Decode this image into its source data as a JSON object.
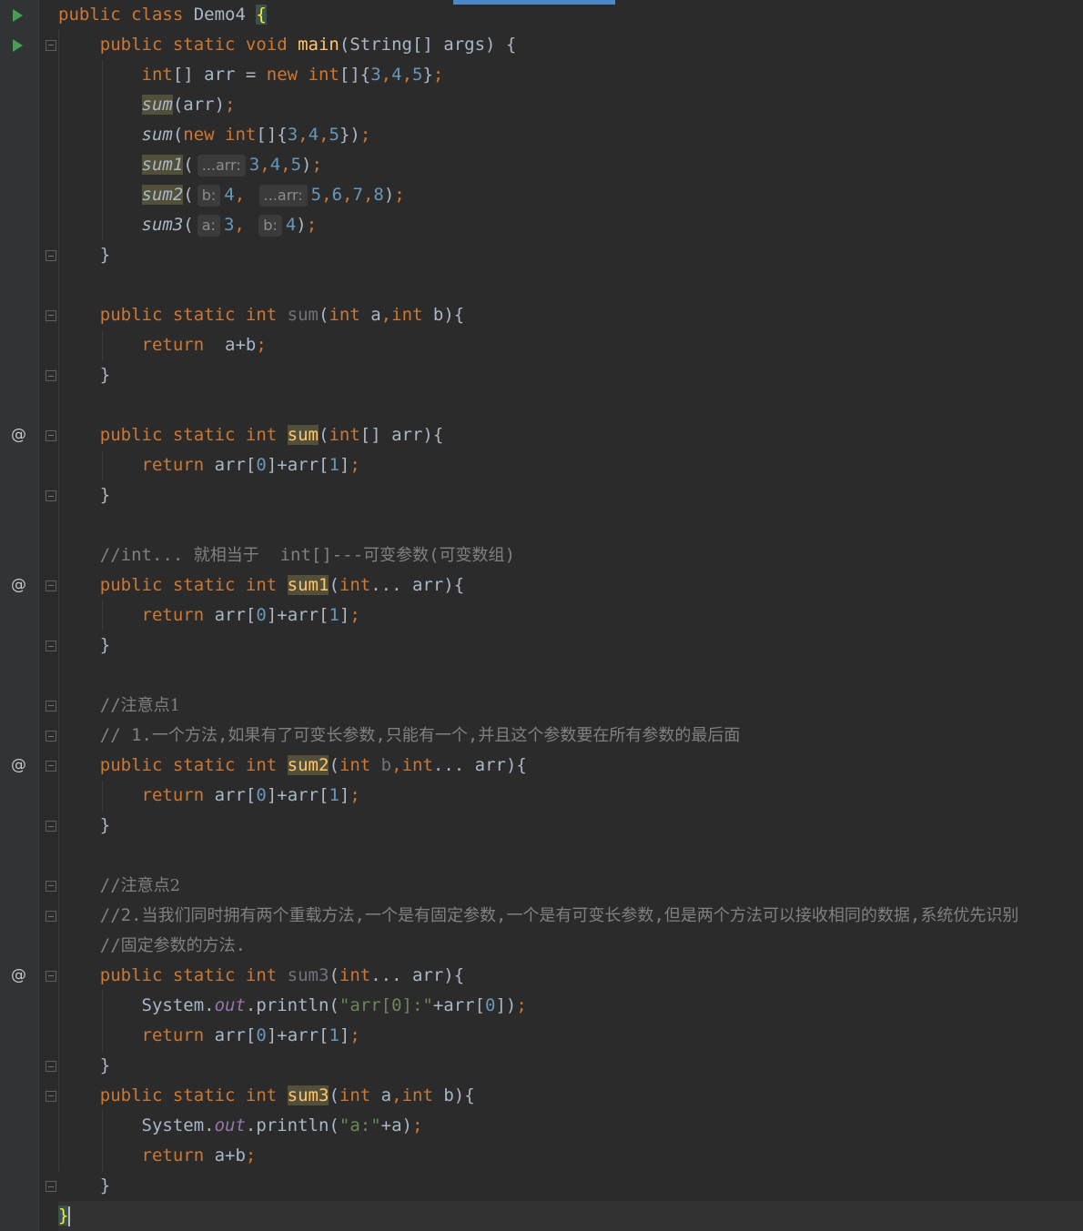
{
  "editor": {
    "language": "java",
    "accent_color": "#4a88c7",
    "lines": [
      {
        "tokens": [
          [
            "kw",
            "public class "
          ],
          [
            "plain",
            "Demo4 "
          ],
          [
            "brace",
            "{"
          ]
        ]
      },
      {
        "tokens": [
          [
            "plain",
            "    "
          ],
          [
            "kw",
            "public static void "
          ],
          [
            "fn",
            "main"
          ],
          [
            "plain",
            "(String[] args) {"
          ]
        ]
      },
      {
        "tokens": [
          [
            "plain",
            "        "
          ],
          [
            "kw",
            "int"
          ],
          [
            "plain",
            "[] arr = "
          ],
          [
            "kw",
            "new int"
          ],
          [
            "plain",
            "[]{"
          ],
          [
            "num",
            "3"
          ],
          [
            "kw",
            ","
          ],
          [
            "num",
            "4"
          ],
          [
            "kw",
            ","
          ],
          [
            "num",
            "5"
          ],
          [
            "plain",
            "}"
          ],
          [
            "kw",
            ";"
          ]
        ]
      },
      {
        "tokens": [
          [
            "plain",
            "        "
          ],
          [
            "callhl",
            "sum"
          ],
          [
            "plain",
            "(arr)"
          ],
          [
            "kw",
            ";"
          ]
        ]
      },
      {
        "tokens": [
          [
            "plain",
            "        "
          ],
          [
            "call",
            "sum"
          ],
          [
            "plain",
            "("
          ],
          [
            "kw",
            "new int"
          ],
          [
            "plain",
            "[]{"
          ],
          [
            "num",
            "3"
          ],
          [
            "kw",
            ","
          ],
          [
            "num",
            "4"
          ],
          [
            "kw",
            ","
          ],
          [
            "num",
            "5"
          ],
          [
            "plain",
            "})"
          ],
          [
            "kw",
            ";"
          ]
        ]
      },
      {
        "tokens": [
          [
            "plain",
            "        "
          ],
          [
            "callhl",
            "sum1"
          ],
          [
            "plain",
            "("
          ],
          [
            "hint",
            "...arr:"
          ],
          [
            "num",
            "3"
          ],
          [
            "kw",
            ","
          ],
          [
            "num",
            "4"
          ],
          [
            "kw",
            ","
          ],
          [
            "num",
            "5"
          ],
          [
            "plain",
            ")"
          ],
          [
            "kw",
            ";"
          ]
        ]
      },
      {
        "tokens": [
          [
            "plain",
            "        "
          ],
          [
            "callhl",
            "sum2"
          ],
          [
            "plain",
            "("
          ],
          [
            "hint",
            "b:"
          ],
          [
            "num",
            "4"
          ],
          [
            "kw",
            ", "
          ],
          [
            "hint",
            "...arr:"
          ],
          [
            "num",
            "5"
          ],
          [
            "kw",
            ","
          ],
          [
            "num",
            "6"
          ],
          [
            "kw",
            ","
          ],
          [
            "num",
            "7"
          ],
          [
            "kw",
            ","
          ],
          [
            "num",
            "8"
          ],
          [
            "plain",
            ")"
          ],
          [
            "kw",
            ";"
          ]
        ]
      },
      {
        "tokens": [
          [
            "plain",
            "        "
          ],
          [
            "call",
            "sum3"
          ],
          [
            "plain",
            "("
          ],
          [
            "hint",
            "a:"
          ],
          [
            "num",
            "3"
          ],
          [
            "kw",
            ", "
          ],
          [
            "hint",
            "b:"
          ],
          [
            "num",
            "4"
          ],
          [
            "plain",
            ")"
          ],
          [
            "kw",
            ";"
          ]
        ]
      },
      {
        "tokens": [
          [
            "plain",
            "    }"
          ]
        ]
      },
      {
        "tokens": []
      },
      {
        "tokens": [
          [
            "plain",
            "    "
          ],
          [
            "kw",
            "public static int "
          ],
          [
            "unused",
            "sum"
          ],
          [
            "plain",
            "("
          ],
          [
            "kw",
            "int "
          ],
          [
            "plain",
            "a"
          ],
          [
            "kw",
            ","
          ],
          [
            "kw",
            "int "
          ],
          [
            "plain",
            "b){"
          ]
        ]
      },
      {
        "tokens": [
          [
            "plain",
            "        "
          ],
          [
            "kw",
            "return  "
          ],
          [
            "plain",
            "a+b"
          ],
          [
            "kw",
            ";"
          ]
        ]
      },
      {
        "tokens": [
          [
            "plain",
            "    }"
          ]
        ]
      },
      {
        "tokens": []
      },
      {
        "tokens": [
          [
            "plain",
            "    "
          ],
          [
            "kw",
            "public static int "
          ],
          [
            "fnhl",
            "sum"
          ],
          [
            "plain",
            "("
          ],
          [
            "kw",
            "int"
          ],
          [
            "plain",
            "[] arr){"
          ]
        ]
      },
      {
        "tokens": [
          [
            "plain",
            "        "
          ],
          [
            "kw",
            "return "
          ],
          [
            "plain",
            "arr["
          ],
          [
            "num",
            "0"
          ],
          [
            "plain",
            "]+arr["
          ],
          [
            "num",
            "1"
          ],
          [
            "plain",
            "]"
          ],
          [
            "kw",
            ";"
          ]
        ]
      },
      {
        "tokens": [
          [
            "plain",
            "    }"
          ]
        ]
      },
      {
        "tokens": []
      },
      {
        "tokens": [
          [
            "plain",
            "    "
          ],
          [
            "cm",
            "//int... "
          ],
          [
            "cmcn",
            "就相当于"
          ],
          [
            "cm",
            "  int[]---"
          ],
          [
            "cmcn",
            "可变参数"
          ],
          [
            "cm",
            "("
          ],
          [
            "cmcn",
            "可变数组"
          ],
          [
            "cm",
            ")"
          ]
        ]
      },
      {
        "tokens": [
          [
            "plain",
            "    "
          ],
          [
            "kw",
            "public static int "
          ],
          [
            "fnhl",
            "sum1"
          ],
          [
            "plain",
            "("
          ],
          [
            "kw",
            "int"
          ],
          [
            "plain",
            "... arr){"
          ]
        ]
      },
      {
        "tokens": [
          [
            "plain",
            "        "
          ],
          [
            "kw",
            "return "
          ],
          [
            "plain",
            "arr["
          ],
          [
            "num",
            "0"
          ],
          [
            "plain",
            "]+arr["
          ],
          [
            "num",
            "1"
          ],
          [
            "plain",
            "]"
          ],
          [
            "kw",
            ";"
          ]
        ]
      },
      {
        "tokens": [
          [
            "plain",
            "    }"
          ]
        ]
      },
      {
        "tokens": []
      },
      {
        "tokens": [
          [
            "plain",
            "    "
          ],
          [
            "cm",
            "//"
          ],
          [
            "cmcn",
            "注意点1"
          ]
        ]
      },
      {
        "tokens": [
          [
            "plain",
            "    "
          ],
          [
            "cm",
            "// 1."
          ],
          [
            "cmcn",
            "一个方法"
          ],
          [
            "cm",
            ","
          ],
          [
            "cmcn",
            "如果有了可变长参数"
          ],
          [
            "cm",
            ","
          ],
          [
            "cmcn",
            "只能有一个"
          ],
          [
            "cm",
            ","
          ],
          [
            "cmcn",
            "并且这个参数要在所有参数的最后面"
          ]
        ]
      },
      {
        "tokens": [
          [
            "plain",
            "    "
          ],
          [
            "kw",
            "public static int "
          ],
          [
            "fnhl",
            "sum2"
          ],
          [
            "plain",
            "("
          ],
          [
            "kw",
            "int "
          ],
          [
            "unused",
            "b"
          ],
          [
            "kw",
            ","
          ],
          [
            "kw",
            "int"
          ],
          [
            "plain",
            "... arr){"
          ]
        ]
      },
      {
        "tokens": [
          [
            "plain",
            "        "
          ],
          [
            "kw",
            "return "
          ],
          [
            "plain",
            "arr["
          ],
          [
            "num",
            "0"
          ],
          [
            "plain",
            "]+arr["
          ],
          [
            "num",
            "1"
          ],
          [
            "plain",
            "]"
          ],
          [
            "kw",
            ";"
          ]
        ]
      },
      {
        "tokens": [
          [
            "plain",
            "    }"
          ]
        ]
      },
      {
        "tokens": []
      },
      {
        "tokens": [
          [
            "plain",
            "    "
          ],
          [
            "cm",
            "//"
          ],
          [
            "cmcn",
            "注意点2"
          ]
        ]
      },
      {
        "tokens": [
          [
            "plain",
            "    "
          ],
          [
            "cm",
            "//2."
          ],
          [
            "cmcn",
            "当我们同时拥有两个重载方法"
          ],
          [
            "cm",
            ","
          ],
          [
            "cmcn",
            "一个是有固定参数"
          ],
          [
            "cm",
            ","
          ],
          [
            "cmcn",
            "一个是有可变长参数"
          ],
          [
            "cm",
            ","
          ],
          [
            "cmcn",
            "但是两个方法可以接收相同的数据"
          ],
          [
            "cm",
            ","
          ],
          [
            "cmcn",
            "系统优先识别"
          ]
        ]
      },
      {
        "tokens": [
          [
            "plain",
            "    "
          ],
          [
            "cm",
            "//"
          ],
          [
            "cmcn",
            "固定参数的方法"
          ],
          [
            "cm",
            "."
          ]
        ]
      },
      {
        "tokens": [
          [
            "plain",
            "    "
          ],
          [
            "kw",
            "public static int "
          ],
          [
            "unused",
            "sum3"
          ],
          [
            "plain",
            "("
          ],
          [
            "kw",
            "int"
          ],
          [
            "plain",
            "... arr){"
          ]
        ]
      },
      {
        "tokens": [
          [
            "plain",
            "        System."
          ],
          [
            "static",
            "out"
          ],
          [
            "plain",
            ".println("
          ],
          [
            "str",
            "\"arr[0]:\""
          ],
          [
            "plain",
            "+arr["
          ],
          [
            "num",
            "0"
          ],
          [
            "plain",
            "])"
          ],
          [
            "kw",
            ";"
          ]
        ]
      },
      {
        "tokens": [
          [
            "plain",
            "        "
          ],
          [
            "kw",
            "return "
          ],
          [
            "plain",
            "arr["
          ],
          [
            "num",
            "0"
          ],
          [
            "plain",
            "]+arr["
          ],
          [
            "num",
            "1"
          ],
          [
            "plain",
            "]"
          ],
          [
            "kw",
            ";"
          ]
        ]
      },
      {
        "tokens": [
          [
            "plain",
            "    }"
          ]
        ]
      },
      {
        "tokens": [
          [
            "plain",
            "    "
          ],
          [
            "kw",
            "public static int "
          ],
          [
            "fnhl",
            "sum3"
          ],
          [
            "plain",
            "("
          ],
          [
            "kw",
            "int "
          ],
          [
            "plain",
            "a"
          ],
          [
            "kw",
            ","
          ],
          [
            "kw",
            "int "
          ],
          [
            "plain",
            "b){"
          ]
        ]
      },
      {
        "tokens": [
          [
            "plain",
            "        System."
          ],
          [
            "static",
            "out"
          ],
          [
            "plain",
            ".println("
          ],
          [
            "str",
            "\"a:\""
          ],
          [
            "plain",
            "+a)"
          ],
          [
            "kw",
            ";"
          ]
        ]
      },
      {
        "tokens": [
          [
            "plain",
            "        "
          ],
          [
            "kw",
            "return "
          ],
          [
            "plain",
            "a+b"
          ],
          [
            "kw",
            ";"
          ]
        ]
      },
      {
        "tokens": [
          [
            "plain",
            "    }"
          ]
        ]
      },
      {
        "tokens": [
          [
            "brace",
            "}"
          ],
          [
            "caret",
            ""
          ]
        ]
      }
    ]
  },
  "gutter": {
    "run_lines": [
      0,
      1
    ],
    "override_lines": [
      14,
      19,
      25,
      32
    ],
    "override_symbol": "@",
    "fold_open_lines": [
      1,
      10,
      14,
      19,
      23,
      25,
      29,
      32,
      36
    ],
    "fold_close_lines": [
      8,
      12,
      16,
      21,
      24,
      27,
      30,
      35,
      39
    ]
  }
}
